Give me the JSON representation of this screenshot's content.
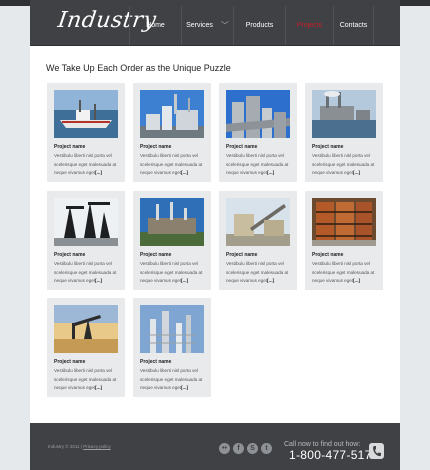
{
  "header": {
    "logo": "Industry"
  },
  "nav": {
    "items": [
      {
        "label": "Home",
        "active": false,
        "dropdown": false
      },
      {
        "label": "Services",
        "active": false,
        "dropdown": true
      },
      {
        "label": "Products",
        "active": false,
        "dropdown": false
      },
      {
        "label": "Projects",
        "active": true,
        "dropdown": false
      },
      {
        "label": "Contacts",
        "active": false,
        "dropdown": false
      }
    ]
  },
  "main": {
    "title": "We Take Up Each Order as the Unique Puzzle",
    "projects": [
      {
        "name": "Project name",
        "text": "Vestibulu liberti nisl porta vel scelerisque eget malesuada at neque vivamus eget",
        "more": "[...]",
        "image": "fishing-boat"
      },
      {
        "name": "Project name",
        "text": "Vestibulu liberti nisl porta vel scelerisque eget malesuada at neque vivamus eget",
        "more": "[...]",
        "image": "refinery-tanks"
      },
      {
        "name": "Project name",
        "text": "Vestibulu liberti nisl porta vel scelerisque eget malesuada at neque vivamus eget",
        "more": "[...]",
        "image": "industrial-pipes"
      },
      {
        "name": "Project name",
        "text": "Vestibulu liberti nisl porta vel scelerisque eget malesuada at neque vivamus eget",
        "more": "[...]",
        "image": "power-plant-shore"
      },
      {
        "name": "Project name",
        "text": "Vestibulu liberti nisl porta vel scelerisque eget malesuada at neque vivamus eget",
        "more": "[...]",
        "image": "port-cranes"
      },
      {
        "name": "Project name",
        "text": "Vestibulu liberti nisl porta vel scelerisque eget malesuada at neque vivamus eget",
        "more": "[...]",
        "image": "factory-chimneys"
      },
      {
        "name": "Project name",
        "text": "Vestibulu liberti nisl porta vel scelerisque eget malesuada at neque vivamus eget",
        "more": "[...]",
        "image": "conveyor-plant"
      },
      {
        "name": "Project name",
        "text": "Vestibulu liberti nisl porta vel scelerisque eget malesuada at neque vivamus eget",
        "more": "[...]",
        "image": "warehouse-racks"
      },
      {
        "name": "Project name",
        "text": "Vestibulu liberti nisl porta vel scelerisque eget malesuada at neque vivamus eget",
        "more": "[...]",
        "image": "oil-pumpjack"
      },
      {
        "name": "Project name",
        "text": "Vestibulu liberti nisl porta vel scelerisque eget malesuada at neque vivamus eget",
        "more": "[...]",
        "image": "refinery-towers"
      }
    ]
  },
  "footer": {
    "copyright": "Industry © 2011 |",
    "privacy": "Privacy policy",
    "social": [
      {
        "icon": "flickr-icon",
        "glyph": "••"
      },
      {
        "icon": "facebook-icon",
        "glyph": "f"
      },
      {
        "icon": "skype-icon",
        "glyph": "S"
      },
      {
        "icon": "twitter-icon",
        "glyph": "t"
      }
    ],
    "call_text": "Call now to find out how:",
    "phone": "1-800-477-5175"
  },
  "colors": {
    "header_bg": "#3f4144",
    "active_nav": "#c8202a",
    "card_bg": "#e9eaec",
    "page_bg": "#e6e9ec"
  }
}
